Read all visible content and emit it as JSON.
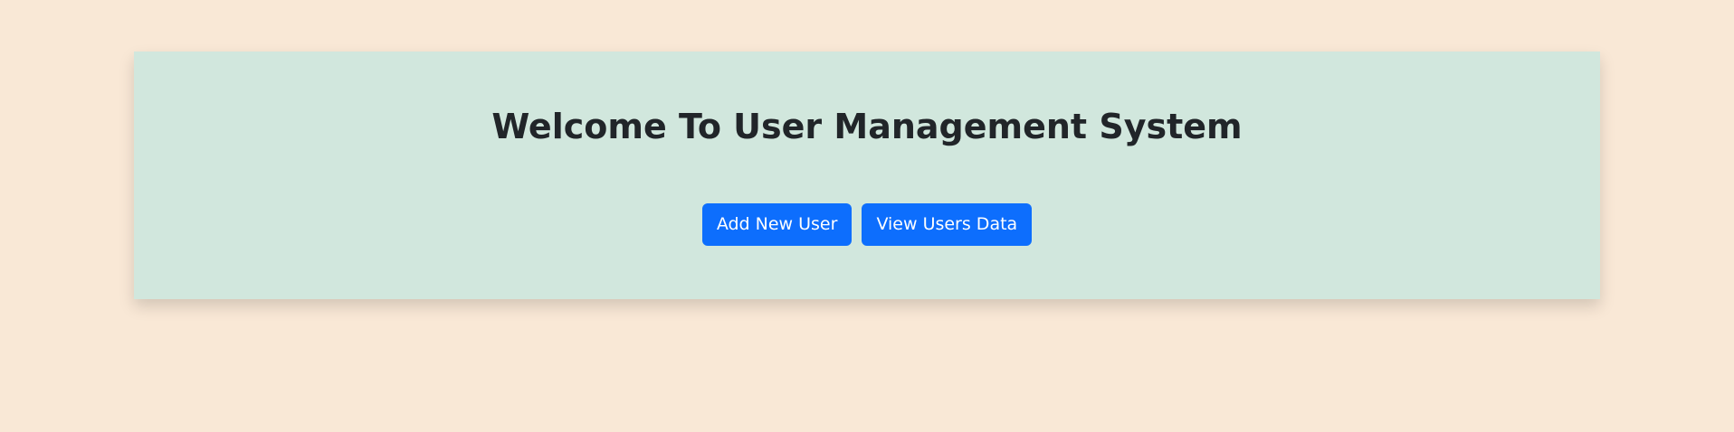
{
  "page": {
    "title": "Welcome To User Management System"
  },
  "actions": {
    "add_user_label": "Add New User",
    "view_users_label": "View Users Data"
  },
  "colors": {
    "page_background": "#f9e8d6",
    "panel_background": "#d1e7dd",
    "primary_button": "#0d6efd",
    "title_text": "#212529"
  }
}
